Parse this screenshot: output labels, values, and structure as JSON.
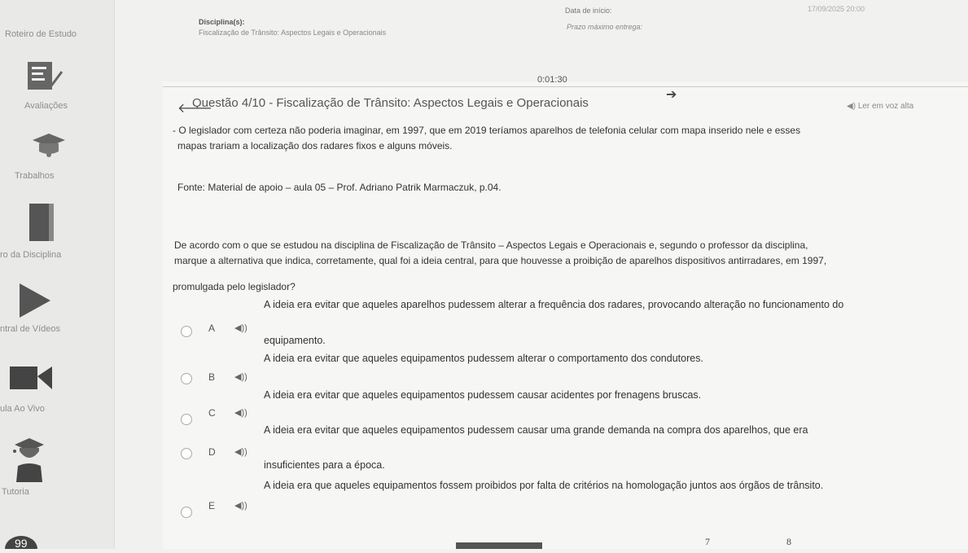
{
  "sidebar": {
    "items": [
      {
        "label": "Roteiro de Estudo",
        "icon": "document-icon"
      },
      {
        "label": "Avaliações",
        "icon": "clipboard-check-icon"
      },
      {
        "label": "Trabalhos",
        "icon": "graduation-cap-icon"
      },
      {
        "label": "ro da Disciplina",
        "icon": "book-icon"
      },
      {
        "label": "ntral de Vídeos",
        "icon": "play-icon"
      },
      {
        "label": "ula Ao Vivo",
        "icon": "video-camera-icon"
      },
      {
        "label": "Tutoria",
        "icon": "tutor-icon"
      }
    ]
  },
  "header": {
    "disciplinas_label": "Disciplina(s):",
    "disciplina_value": "Fiscalização de Trânsito: Aspectos Legais e Operacionais",
    "data_inicio_label": "Data de início:",
    "data_inicio_value": "17/09/2025 20:00",
    "prazo_label": "Prazo máximo entrega:"
  },
  "timer": "0:01:30",
  "question": {
    "title": "Questão 4/10 - Fiscalização de Trânsito: Aspectos Legais e Operacionais",
    "read_aloud": "Ler em voz alta",
    "context_line1": "- O legislador com certeza não poderia imaginar, em 1997, que em 2019 teríamos aparelhos de telefonia celular com mapa inserido nele e esses",
    "context_line2": "mapas trariam a localização dos radares fixos e alguns móveis.",
    "source": "Fonte: Material de apoio – aula 05 – Prof. Adriano Patrik Marmaczuk, p.04.",
    "prompt_line1": "De acordo com o que se estudou na disciplina de Fiscalização de Trânsito – Aspectos Legais e Operacionais e, segundo o professor da disciplina,",
    "prompt_line2": "marque a alternativa que indica, corretamente, qual foi a ideia central, para que houvesse a proibição de aparelhos dispositivos antirradares, em 1997,",
    "prompt_line3": "promulgada pelo legislador?"
  },
  "alternatives": [
    {
      "letter": "A",
      "line1": "A ideia era evitar que aqueles aparelhos pudessem alterar a frequência dos radares, provocando alteração no funcionamento do",
      "line2": "equipamento."
    },
    {
      "letter": "B",
      "line1": "A ideia era evitar que aqueles equipamentos pudessem alterar o comportamento dos condutores.",
      "line2": ""
    },
    {
      "letter": "C",
      "line1": "A ideia era evitar que aqueles equipamentos pudessem causar acidentes por frenagens bruscas.",
      "line2": ""
    },
    {
      "letter": "D",
      "line1": "A ideia era evitar que aqueles equipamentos pudessem causar uma grande demanda na compra dos aparelhos, que era",
      "line2": "insuficientes para a época."
    },
    {
      "letter": "E",
      "line1": "A ideia era que aqueles equipamentos fossem proibidos por falta de critérios na homologação juntos aos órgãos de trânsito.",
      "line2": ""
    }
  ],
  "pagination": {
    "page_7": "7",
    "page_8": "8"
  },
  "colors": {
    "accent": "#555555",
    "sidebar": "#e9e9e7",
    "background": "#f1f1ef"
  }
}
